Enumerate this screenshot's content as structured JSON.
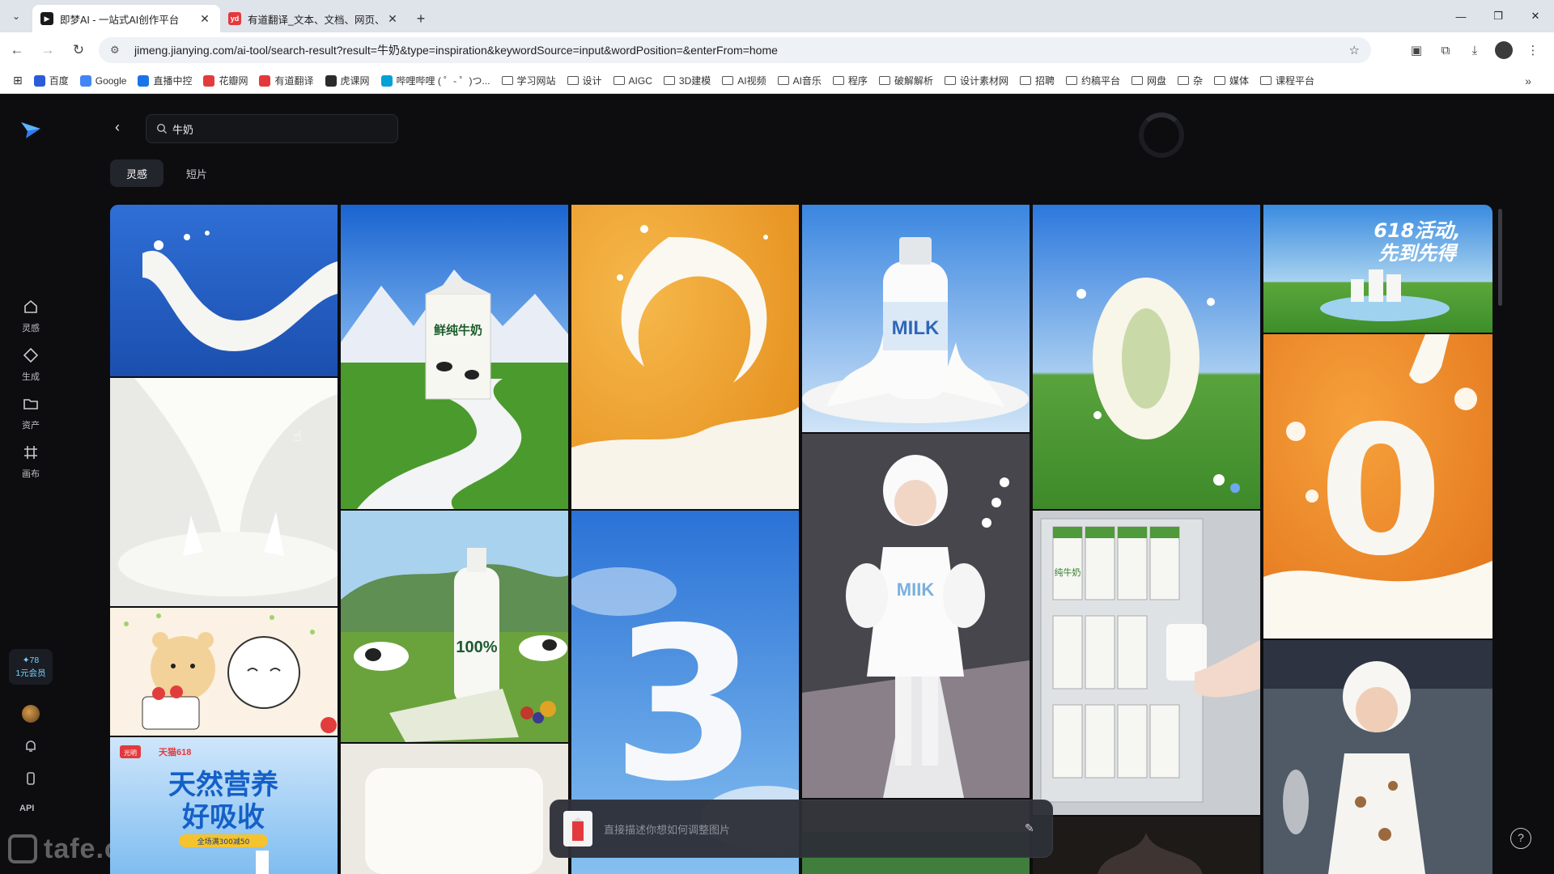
{
  "browser": {
    "tabs": [
      {
        "title": "即梦AI - 一站式AI创作平台",
        "favicon_color": "#1a1a1a",
        "favicon_glyph": "▶",
        "active": true
      },
      {
        "title": "有道翻译_文本、文档、网页、",
        "favicon_color": "#e4393c",
        "favicon_glyph": "yd",
        "active": false
      }
    ],
    "url": "jimeng.jianying.com/ai-tool/search-result?result=牛奶&type=inspiration&keywordSource=input&wordPosition=&enterFrom=home",
    "bookmarks": [
      {
        "label": "百度",
        "kind": "icon",
        "color": "#2b5bd7"
      },
      {
        "label": "Google",
        "kind": "icon",
        "color": "#4285f4"
      },
      {
        "label": "直播中控",
        "kind": "icon",
        "color": "#1a73e8"
      },
      {
        "label": "花瓣网",
        "kind": "icon",
        "color": "#e23b3b"
      },
      {
        "label": "有道翻译",
        "kind": "icon",
        "color": "#e4393c"
      },
      {
        "label": "虎课网",
        "kind": "icon",
        "color": "#2b2b2b"
      },
      {
        "label": "哔哩哔哩 ( ゜- ゜)つ...",
        "kind": "icon",
        "color": "#00a1d6"
      },
      {
        "label": "学习网站",
        "kind": "folder"
      },
      {
        "label": "设计",
        "kind": "folder"
      },
      {
        "label": "AIGC",
        "kind": "folder"
      },
      {
        "label": "3D建模",
        "kind": "folder"
      },
      {
        "label": "AI视频",
        "kind": "folder"
      },
      {
        "label": "AI音乐",
        "kind": "folder"
      },
      {
        "label": "程序",
        "kind": "folder"
      },
      {
        "label": "破解解析",
        "kind": "folder"
      },
      {
        "label": "设计素材网",
        "kind": "folder"
      },
      {
        "label": "招聘",
        "kind": "folder"
      },
      {
        "label": "约稿平台",
        "kind": "folder"
      },
      {
        "label": "网盘",
        "kind": "folder"
      },
      {
        "label": "杂",
        "kind": "folder"
      },
      {
        "label": "媒体",
        "kind": "folder"
      },
      {
        "label": "课程平台",
        "kind": "folder"
      }
    ]
  },
  "sidebar": {
    "items": [
      {
        "label": "灵感",
        "icon": "home-icon"
      },
      {
        "label": "生成",
        "icon": "diamond-icon"
      },
      {
        "label": "资产",
        "icon": "folder-icon"
      },
      {
        "label": "画布",
        "icon": "canvas-icon"
      }
    ],
    "vip": {
      "line1": "✦78",
      "line2": "1元会员"
    },
    "api_label": "API",
    "watermark": "tafe.cc"
  },
  "search": {
    "query": "牛奶"
  },
  "content_tabs": [
    {
      "label": "灵感",
      "active": true
    },
    {
      "label": "短片",
      "active": false
    }
  ],
  "cards": [
    {
      "id": "milk-wave-blue"
    },
    {
      "id": "milk-pour-splash"
    },
    {
      "id": "bear-cake-cartoon"
    },
    {
      "id": "poster-tmall-618",
      "text_main": "天然营养",
      "text_sub": "好吸收",
      "badge": "天猫618",
      "brand": "光明",
      "coupon": "全场满300减50"
    },
    {
      "id": "carton-mountain",
      "carton_text": "鲜纯牛奶"
    },
    {
      "id": "bottle-cows-field",
      "bottle_text": "100%"
    },
    {
      "id": "cream-blank"
    },
    {
      "id": "orange-splash"
    },
    {
      "id": "number-3-sky",
      "number": "3"
    },
    {
      "id": "milk-bottle-splash",
      "bottle_text": "MILK"
    },
    {
      "id": "milk-girl-runway",
      "dress_text": "MIIK"
    },
    {
      "id": "milk-ring-grass"
    },
    {
      "id": "fridge-cartons",
      "carton_text": "纯牛奶"
    },
    {
      "id": "poster-618-grass",
      "text_main": "618活动,",
      "text_sub": "先到先得"
    },
    {
      "id": "number-0-orange",
      "number": "0"
    },
    {
      "id": "boy-runway"
    }
  ],
  "prompt": {
    "placeholder": "直接描述你想如何调整图片"
  },
  "colors": {
    "accent_blue": "#2d8cf0",
    "background": "#0d0d0f",
    "vip_text": "#74d5ff"
  }
}
